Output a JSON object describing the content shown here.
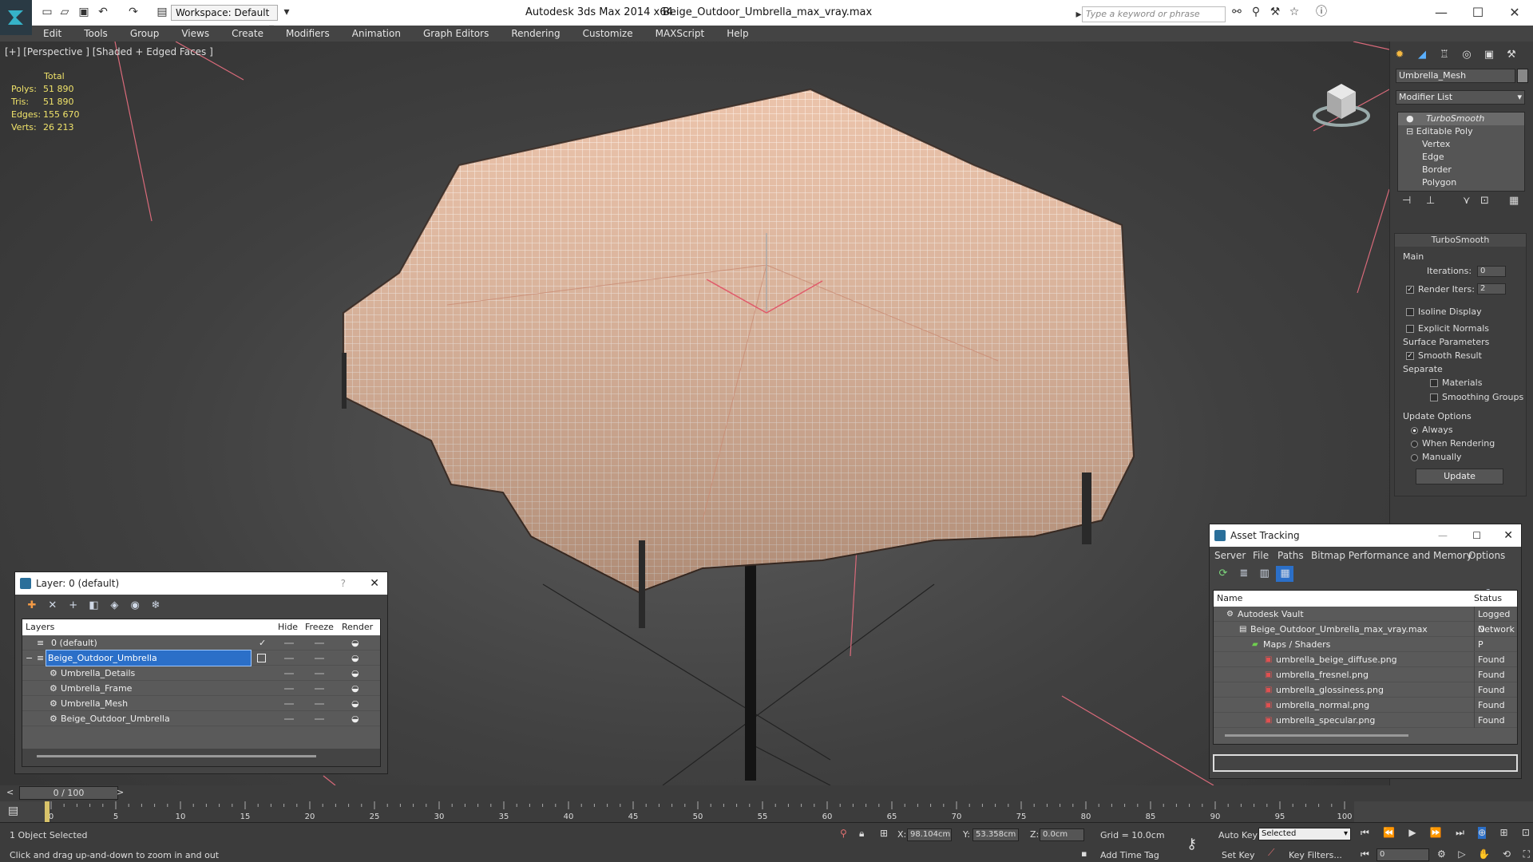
{
  "titlebar": {
    "workspace": "Workspace: Default",
    "app": "Autodesk 3ds Max  2014 x64",
    "file": "Beige_Outdoor_Umbrella_max_vray.max",
    "search_placeholder": "Type a keyword or phrase"
  },
  "menu": [
    "Edit",
    "Tools",
    "Group",
    "Views",
    "Create",
    "Modifiers",
    "Animation",
    "Graph Editors",
    "Rendering",
    "Customize",
    "MAXScript",
    "Help"
  ],
  "viewport": {
    "label": "[+] [Perspective ] [Shaded + Edged Faces ]",
    "stats_header": "Total",
    "stats": [
      {
        "k": "Polys:",
        "v": "51 890"
      },
      {
        "k": "Tris:",
        "v": "51 890"
      },
      {
        "k": "Edges:",
        "v": "155 670"
      },
      {
        "k": "Verts:",
        "v": "26 213"
      }
    ]
  },
  "command_panel": {
    "object_name": "Umbrella_Mesh",
    "modifier_list": "Modifier List",
    "stack": [
      "TurboSmooth",
      "Editable Poly",
      "Vertex",
      "Edge",
      "Border",
      "Polygon"
    ],
    "rollout_title": "TurboSmooth",
    "main_label": "Main",
    "iterations_label": "Iterations:",
    "iterations": "0",
    "render_iters_label": "Render Iters:",
    "render_iters": "2",
    "isoline": "Isoline Display",
    "explicit_normals": "Explicit Normals",
    "surface_params": "Surface Parameters",
    "smooth_result": "Smooth Result",
    "separate": "Separate",
    "materials": "Materials",
    "smoothing_groups": "Smoothing Groups",
    "update_options": "Update Options",
    "always": "Always",
    "when_rendering": "When Rendering",
    "manually": "Manually",
    "update_button": "Update"
  },
  "layer_panel": {
    "title": "Layer: 0 (default)",
    "help": "?",
    "headers": {
      "layers": "Layers",
      "hide": "Hide",
      "freeze": "Freeze",
      "render": "Render"
    },
    "rows": [
      {
        "name": "0 (default)",
        "indent": 0
      },
      {
        "name": "Beige_Outdoor_Umbrella",
        "indent": 0
      },
      {
        "name": "Umbrella_Details",
        "indent": 1
      },
      {
        "name": "Umbrella_Frame",
        "indent": 1
      },
      {
        "name": "Umbrella_Mesh",
        "indent": 1
      },
      {
        "name": "Beige_Outdoor_Umbrella",
        "indent": 1
      }
    ]
  },
  "asset_panel": {
    "title": "Asset Tracking",
    "menu": [
      "Server",
      "File",
      "Paths",
      "Bitmap Performance and Memory",
      "Options"
    ],
    "headers": {
      "name": "Name",
      "status": "Status"
    },
    "rows": [
      {
        "name": "Autodesk Vault",
        "status": "Logged O",
        "indent": 1
      },
      {
        "name": "Beige_Outdoor_Umbrella_max_vray.max",
        "status": "Network P",
        "indent": 2
      },
      {
        "name": "Maps / Shaders",
        "status": "",
        "indent": 3
      },
      {
        "name": "umbrella_beige_diffuse.png",
        "status": "Found",
        "indent": 4
      },
      {
        "name": "umbrella_fresnel.png",
        "status": "Found",
        "indent": 4
      },
      {
        "name": "umbrella_glossiness.png",
        "status": "Found",
        "indent": 4
      },
      {
        "name": "umbrella_normal.png",
        "status": "Found",
        "indent": 4
      },
      {
        "name": "umbrella_specular.png",
        "status": "Found",
        "indent": 4
      }
    ]
  },
  "timeline": {
    "frame": "0 / 100",
    "ticks": [
      "0",
      "5",
      "10",
      "15",
      "20",
      "25",
      "30",
      "35",
      "40",
      "45",
      "50",
      "55",
      "60",
      "65",
      "70",
      "75",
      "80",
      "85",
      "90",
      "95",
      "100"
    ]
  },
  "status": {
    "selected": "1 Object Selected",
    "hint": "Click and drag up-and-down to zoom in and out",
    "x_label": "X:",
    "x": "98.104cm",
    "y_label": "Y:",
    "y": "53.358cm",
    "z_label": "Z:",
    "z": "0.0cm",
    "grid": "Grid = 10.0cm",
    "add_time_tag": "Add Time Tag",
    "auto_key": "Auto Key",
    "set_key": "Set Key",
    "selected_dropdown": "Selected",
    "key_filters": "Key Filters...",
    "frame_field": "0"
  }
}
